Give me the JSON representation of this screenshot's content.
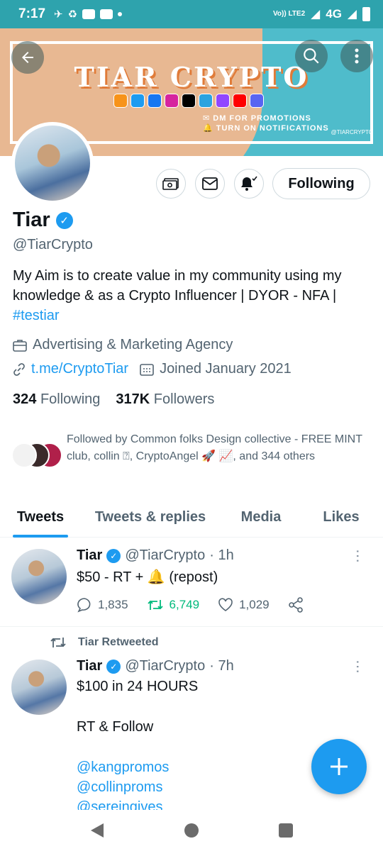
{
  "status_bar": {
    "time": "7:17",
    "volte": "Vo)) LTE2",
    "network": "4G"
  },
  "header": {
    "banner": {
      "brand_text": "TIAR CRYPTO",
      "promo_lines": [
        "✉ DM FOR PROMOTIONS",
        "🔔 TURN ON NOTIFICATIONS"
      ],
      "handle_mark": "@TIARCRYPTO"
    },
    "back_icon": "arrow-left",
    "search_icon": "search",
    "more_icon": "more-vertical"
  },
  "profile": {
    "name": "Tiar",
    "handle": "@TiarCrypto",
    "bio_text": "My Aim is to create value in my community using my knowledge & as a Crypto Influencer | DYOR - NFA |",
    "bio_hashtag": "#testiar",
    "category": "Advertising & Marketing Agency",
    "website": "t.me/CryptoTiar",
    "joined": "Joined January 2021",
    "following_count": "324",
    "following_label": "Following",
    "followers_count": "317K",
    "followers_label": "Followers",
    "follow_button": "Following",
    "followed_by": "Followed by Common folks Design collective - FREE MINT club, collin ⍰, CryptoAngel 🚀 📈, and 344 others"
  },
  "tabs": [
    "Tweets",
    "Tweets & replies",
    "Media",
    "Likes"
  ],
  "tweets": [
    {
      "name": "Tiar",
      "handle": "@TiarCrypto",
      "time": "· 1h",
      "text": "$50 - RT + 🔔 (repost)",
      "replies": "1,835",
      "retweets": "6,749",
      "likes": "1,029"
    },
    {
      "retweeted_by": "Tiar Retweeted",
      "name": "Tiar",
      "handle": "@TiarCrypto",
      "time": "· 7h",
      "line1": "$100 in 24 HOURS",
      "line2": "RT & Follow",
      "mention1": "@kangpromos",
      "mention2": "@collinproms",
      "mention3": "@sereingives"
    }
  ],
  "colors": {
    "accent": "#1d9bf0",
    "retweet_green": "#00ba7c",
    "banner_teal": "#4fbccb",
    "banner_sand": "#e8b892"
  }
}
